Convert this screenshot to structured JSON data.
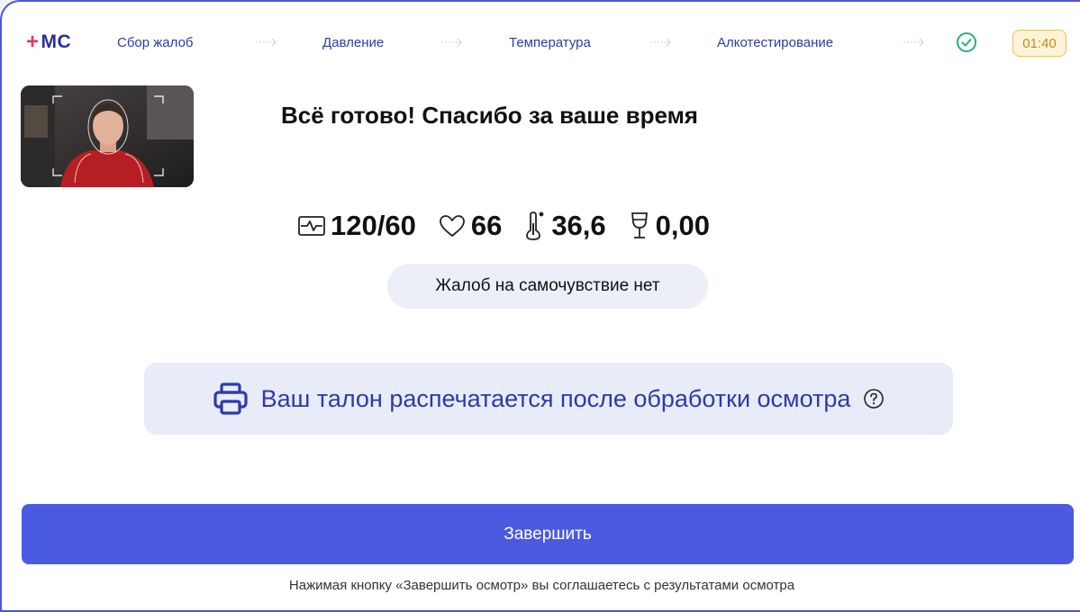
{
  "header": {
    "logo_text": "МС",
    "steps": [
      {
        "label": "Сбор жалоб"
      },
      {
        "label": "Давление"
      },
      {
        "label": "Температура"
      },
      {
        "label": "Алкотестирование"
      }
    ],
    "timer": "01:40"
  },
  "main": {
    "title": "Всё готово! Спасибо за ваше время",
    "vitals": {
      "pressure": "120/60",
      "pulse": "66",
      "temperature": "36,6",
      "alcohol": "0,00"
    },
    "complaints": "Жалоб на самочувствие нет",
    "notice": "Ваш талон распечатается после обработки осмотра",
    "finish_button": "Завершить",
    "footnote": "Нажимая кнопку «Завершить осмотр» вы соглашаетесь с результатами осмотра"
  },
  "colors": {
    "accent": "#4a5be0",
    "brand": "#2b2f9e",
    "logo_plus": "#e03a6a",
    "success": "#1fb27a",
    "timer_bg": "#fff4d9"
  },
  "icons": [
    "plus-icon",
    "arrow-right-icon",
    "check-circle-icon",
    "pressure-icon",
    "heart-icon",
    "thermometer-icon",
    "wine-glass-icon",
    "printer-icon",
    "help-icon"
  ]
}
